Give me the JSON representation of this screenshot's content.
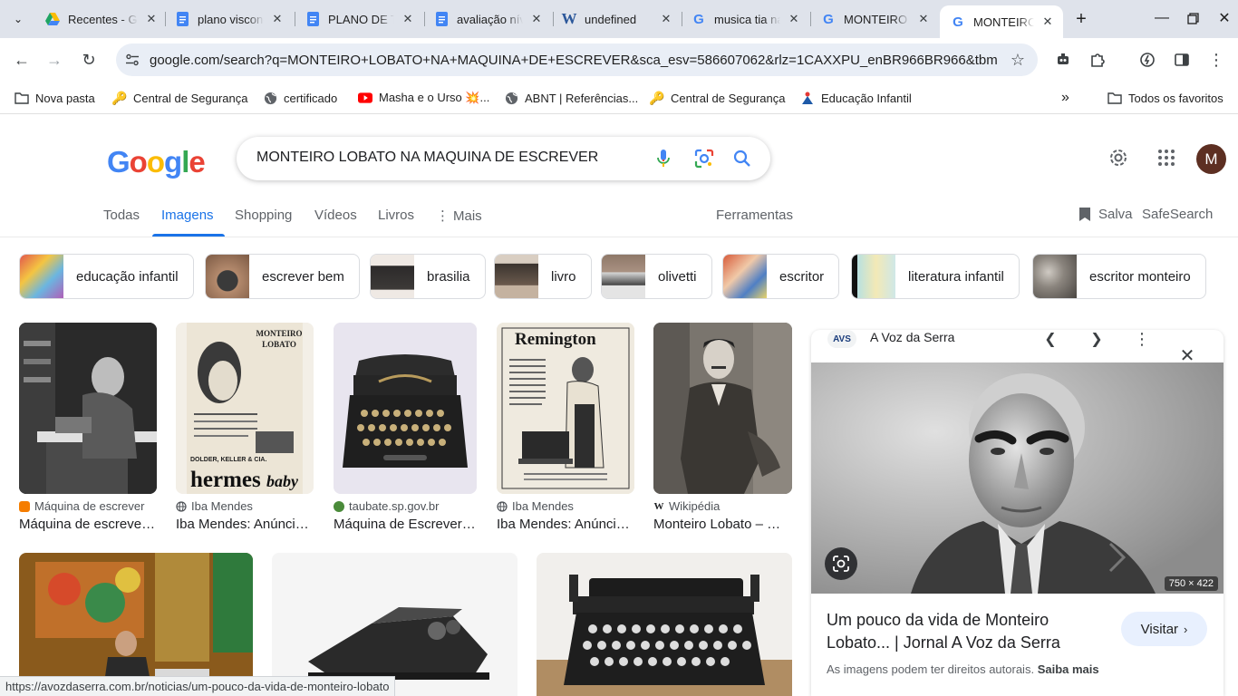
{
  "browser": {
    "tabs": [
      {
        "title": "Recentes - Google Drive"
      },
      {
        "title": "plano visconde"
      },
      {
        "title": "PLANO DE TRABALHO"
      },
      {
        "title": "avaliação nível"
      },
      {
        "title": "undefined"
      },
      {
        "title": "musica tia nastácia"
      },
      {
        "title": "MONTEIRO LOBATO"
      },
      {
        "title": "MONTEIRO LOBATO"
      }
    ],
    "url": "google.com/search?q=MONTEIRO+LOBATO+NA+MAQUINA+DE+ESCREVER&sca_esv=586607062&rlz=1CAXXPU_enBR966BR966&tbm=isch&source=lnms&sa=X&ved",
    "bookmarks": [
      {
        "label": "Nova pasta"
      },
      {
        "label": "Central de Segurança"
      },
      {
        "label": "certificado"
      },
      {
        "label": "Masha e o Urso 💥..."
      },
      {
        "label": "ABNT | Referências..."
      },
      {
        "label": "Central de Segurança"
      },
      {
        "label": "Educação Infantil"
      }
    ],
    "all_bookmarks": "Todos os favoritos",
    "status_url": "https://avozdaserra.com.br/noticias/um-pouco-da-vida-de-monteiro-lobato"
  },
  "google": {
    "logo": [
      "G",
      "o",
      "o",
      "g",
      "l",
      "e"
    ],
    "query": "MONTEIRO LOBATO NA MAQUINA DE ESCREVER",
    "avatar_letter": "M",
    "tabs": [
      "Todas",
      "Imagens",
      "Shopping",
      "Vídeos",
      "Livros",
      "Mais"
    ],
    "tools": "Ferramentas",
    "saved": "Salva",
    "safesearch": "SafeSearch",
    "chips": [
      "educação infantil",
      "escrever bem",
      "brasilia",
      "livro",
      "olivetti",
      "escritor",
      "literatura infantil",
      "escritor monteiro"
    ],
    "results": [
      {
        "source": "Máquina de escrever",
        "title": "Máquina de escrever de Monteiro Lobato"
      },
      {
        "source": "Iba Mendes",
        "title": "Iba Mendes: Anúncios antigos"
      },
      {
        "source": "taubate.sp.gov.br",
        "title": "Máquina de Escrever de Monteiro Lobato"
      },
      {
        "source": "Iba Mendes",
        "title": "Iba Mendes: Anúncios antigos"
      },
      {
        "source": "Wikipédia",
        "title": "Monteiro Lobato – Wikipédia"
      }
    ],
    "poster_text": {
      "hermes_top": "MONTEIRO LOBATO",
      "hermes_brand": "hermes",
      "hermes_baby": "baby",
      "hermes_footer": "DOLDER, KELLER & CIA.",
      "remington": "Remington"
    },
    "panel": {
      "site_badge": "AVS",
      "site": "A Voz da Serra",
      "dims": "750 × 422",
      "title": "Um pouco da vida de Monteiro Lobato... | Jornal A Voz da Serra",
      "visit": "Visitar",
      "rights": "As imagens podem ter direitos autorais.",
      "learn_more": "Saiba mais"
    }
  }
}
